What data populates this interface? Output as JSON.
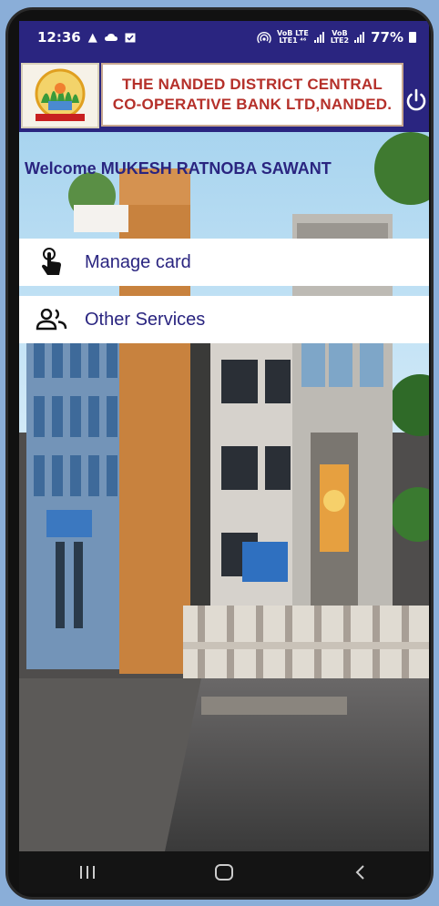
{
  "status_bar": {
    "time": "12:36",
    "network_1_top": "VoB LTE",
    "network_1_bottom": "LTE1 ⁴⁶",
    "network_2_top": "VoB",
    "network_2_bottom": "LTE2",
    "battery": "77%"
  },
  "header": {
    "bank_name_line1": "THE NANDED DISTRICT CENTRAL",
    "bank_name_line2": "CO-OPERATIVE BANK LTD,NANDED."
  },
  "welcome": "Welcome MUKESH RATNOBA SAWANT",
  "menu": [
    {
      "label": "Manage card",
      "icon": "touch-icon"
    },
    {
      "label": "Other Services",
      "icon": "people-icon"
    }
  ],
  "colors": {
    "brand": "#2a2580",
    "title_red": "#b5302a"
  }
}
